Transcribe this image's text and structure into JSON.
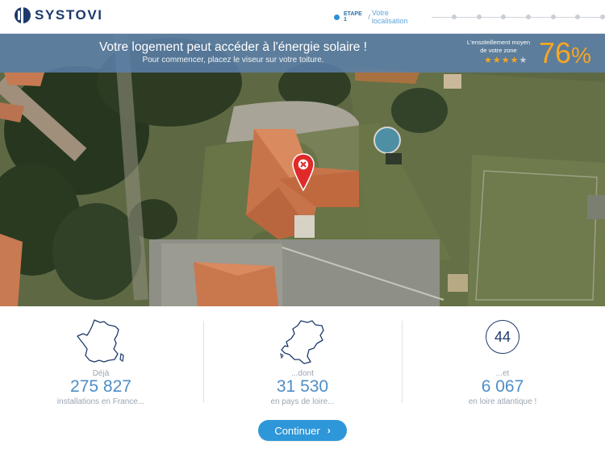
{
  "header": {
    "brand": "SYSTOVI",
    "step": {
      "label": "ETAPE 1",
      "separator": "/",
      "title": "Votre localisation",
      "total_steps": 8,
      "current": 1
    }
  },
  "banner": {
    "title": "Votre logement peut accéder à l'énergie solaire !",
    "subtitle": "Pour commencer, placez le viseur sur votre toiture.",
    "sun_label_line1": "L'ensoleillement moyen",
    "sun_label_line2": "de votre zone",
    "rating": 4,
    "rating_max": 5,
    "percent_value": "76",
    "percent_sign": "%"
  },
  "stats": [
    {
      "icon": "france-map-icon",
      "pre": "Déjà",
      "number": "275 827",
      "post": "installations en France..."
    },
    {
      "icon": "pays-de-loire-map-icon",
      "pre": "...dont",
      "number": "31 530",
      "post": "en pays de loire..."
    },
    {
      "icon": "department-badge-icon",
      "badge": "44",
      "pre": "...et",
      "number": "6 067",
      "post": "en loire atlantique !"
    }
  ],
  "cta": {
    "label": "Continuer",
    "chevron": "›"
  },
  "colors": {
    "brand_navy": "#1c3a6b",
    "accent_blue": "#2e97d9",
    "sun_orange": "#f6a623",
    "marker_red": "#e02a2a",
    "banner_blue": "#5c80aa"
  }
}
